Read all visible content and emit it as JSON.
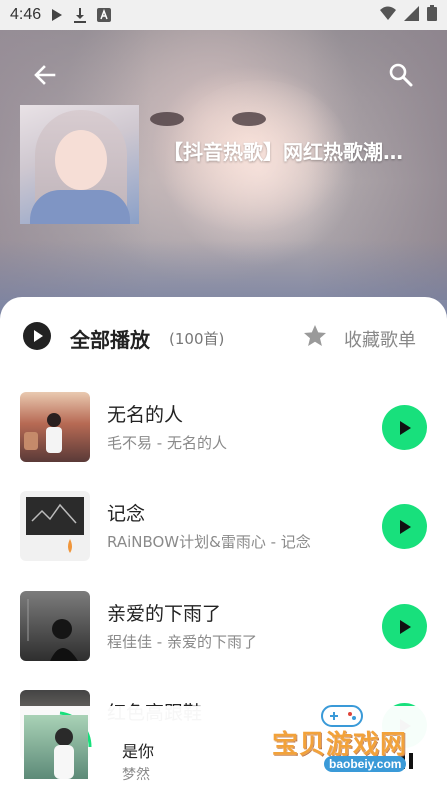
{
  "status_bar": {
    "time": "4:46"
  },
  "playlist": {
    "title": "【抖音热歌】网红热歌潮…"
  },
  "actions": {
    "play_all_label": "全部播放",
    "count_label": "(100首)",
    "favorite_label": "收藏歌单"
  },
  "songs": [
    {
      "name": "无名的人",
      "subtitle": "毛不易 - 无名的人"
    },
    {
      "name": "记念",
      "subtitle": "RAiNBOW计划&雷雨心 - 记念"
    },
    {
      "name": "亲爱的下雨了",
      "subtitle": "程佳佳 - 亲爱的下雨了"
    },
    {
      "name": "红色高跟鞋",
      "subtitle": ""
    }
  ],
  "mini_player": {
    "title": "是你",
    "artist": "梦然"
  },
  "watermark": {
    "text": "宝贝游戏网",
    "url": "baobeiy.com"
  },
  "colors": {
    "accent": "#18e07c"
  }
}
